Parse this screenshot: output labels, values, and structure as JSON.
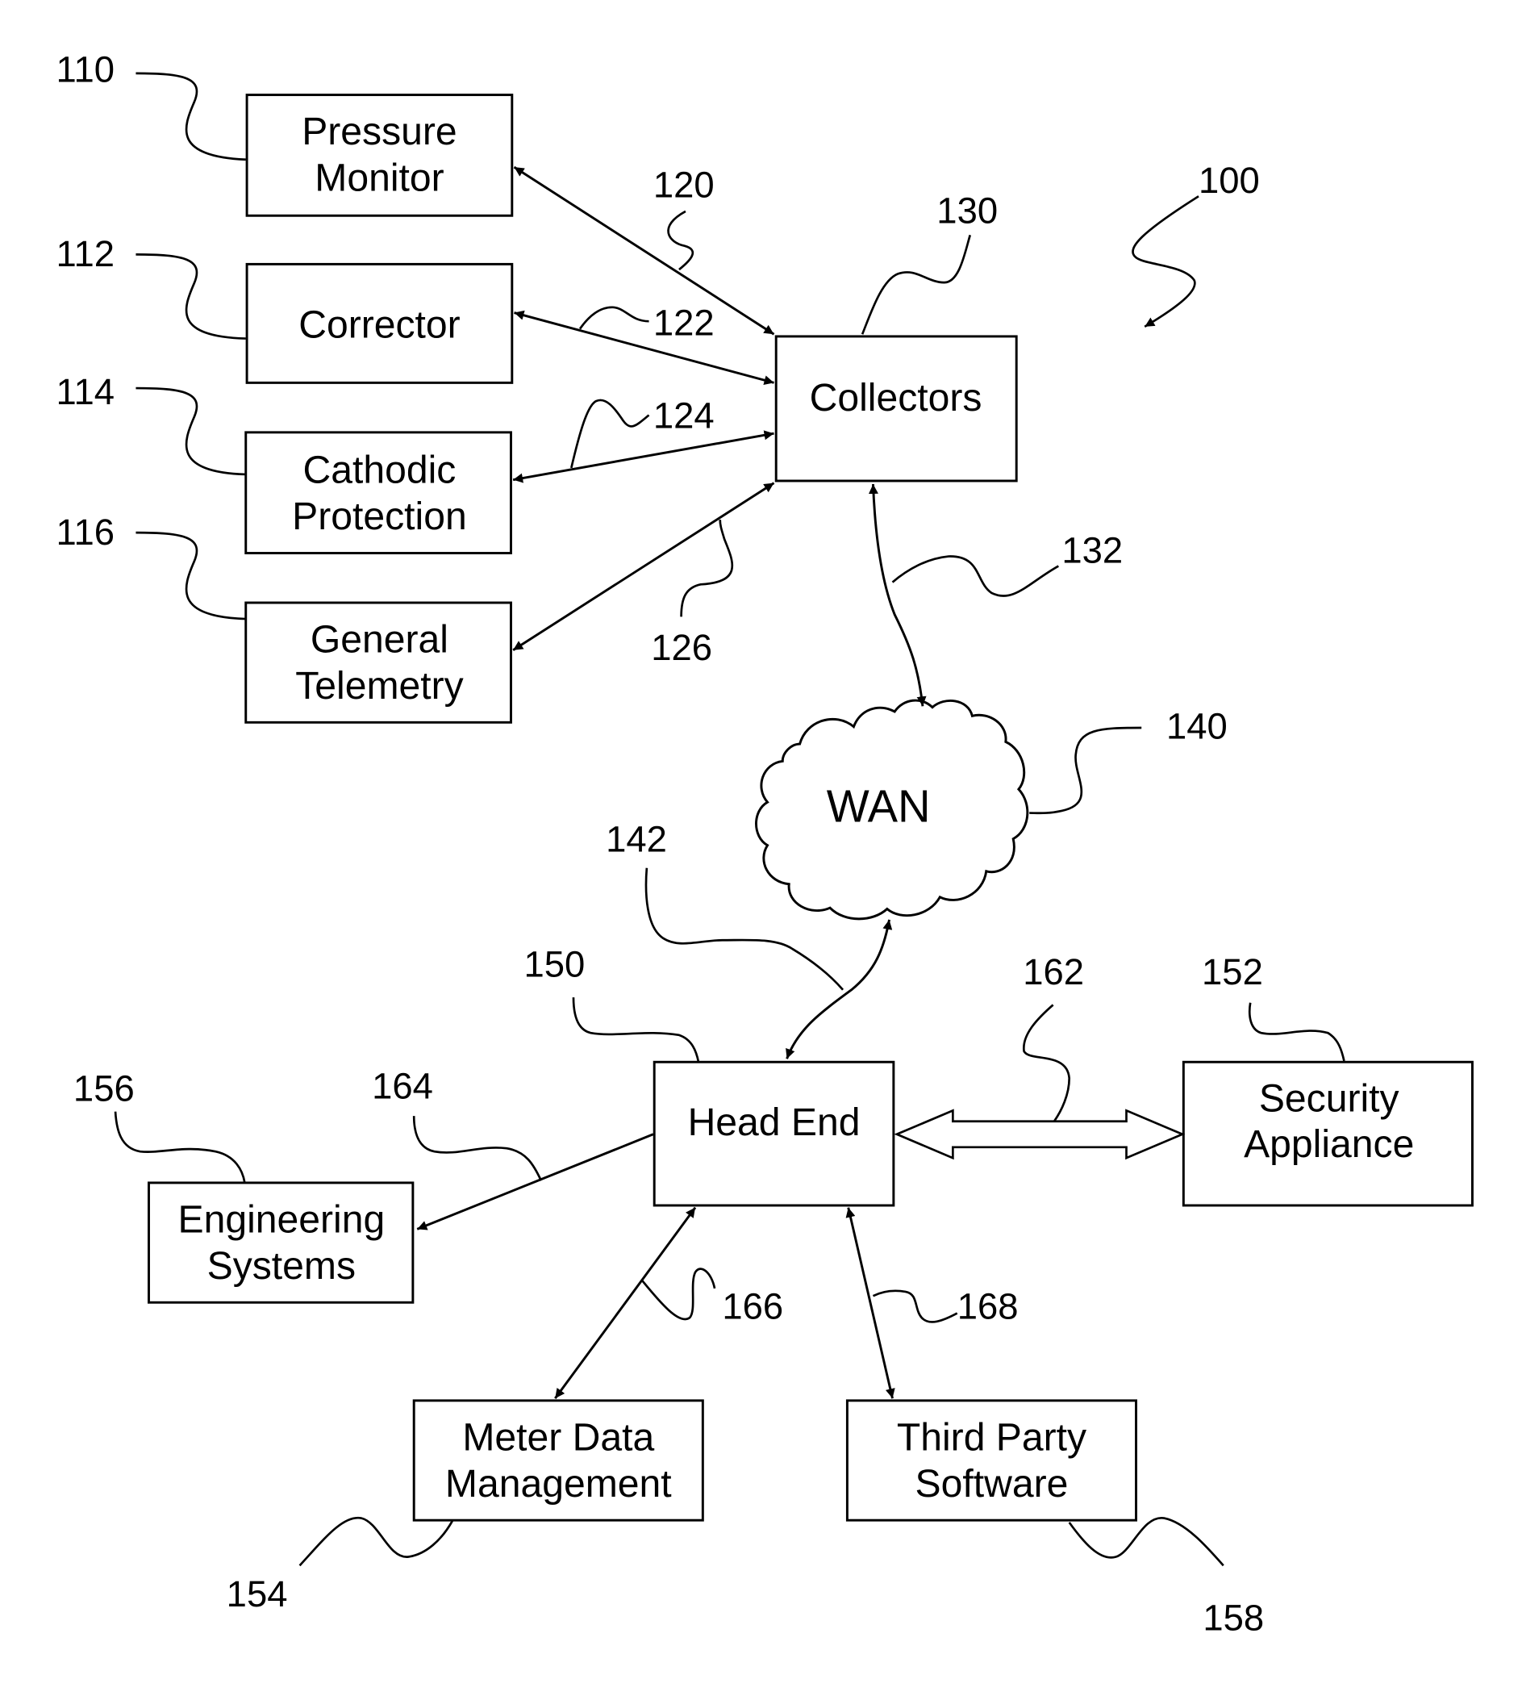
{
  "figure": {
    "system_ref": "100",
    "nodes": {
      "pressure_monitor": {
        "ref": "110",
        "lines": [
          "Pressure",
          "Monitor"
        ]
      },
      "corrector": {
        "ref": "112",
        "lines": [
          "Corrector"
        ]
      },
      "cathodic_protection": {
        "ref": "114",
        "lines": [
          "Cathodic",
          "Protection"
        ]
      },
      "general_telemetry": {
        "ref": "116",
        "lines": [
          "General",
          "Telemetry"
        ]
      },
      "collectors": {
        "ref": "130",
        "lines": [
          "Collectors"
        ]
      },
      "wan": {
        "ref": "140",
        "label": "WAN"
      },
      "head_end": {
        "ref": "150",
        "lines": [
          "Head End"
        ]
      },
      "security_appliance": {
        "ref": "152",
        "lines": [
          "Security",
          "Appliance"
        ]
      },
      "meter_data_management": {
        "ref": "154",
        "lines": [
          "Meter Data",
          "Management"
        ]
      },
      "engineering_systems": {
        "ref": "156",
        "lines": [
          "Engineering",
          "Systems"
        ]
      },
      "third_party_software": {
        "ref": "158",
        "lines": [
          "Third Party",
          "Software"
        ]
      }
    },
    "links": {
      "pm_collectors": {
        "ref": "120",
        "from": "Pressure Monitor",
        "to": "Collectors",
        "direction": "bidirectional"
      },
      "corr_collectors": {
        "ref": "122",
        "from": "Corrector",
        "to": "Collectors",
        "direction": "bidirectional"
      },
      "cp_collectors": {
        "ref": "124",
        "from": "Cathodic Protection",
        "to": "Collectors",
        "direction": "bidirectional"
      },
      "gt_collectors": {
        "ref": "126",
        "from": "General Telemetry",
        "to": "Collectors",
        "direction": "bidirectional"
      },
      "collectors_wan": {
        "ref": "132",
        "from": "Collectors",
        "to": "WAN",
        "direction": "bidirectional"
      },
      "wan_headend": {
        "ref": "142",
        "from": "WAN",
        "to": "Head End",
        "direction": "bidirectional"
      },
      "headend_security": {
        "ref": "162",
        "from": "Head End",
        "to": "Security Appliance",
        "direction": "bidirectional-wide"
      },
      "headend_engineering": {
        "ref": "164",
        "from": "Head End",
        "to": "Engineering Systems",
        "direction": "one-way"
      },
      "headend_mdm": {
        "ref": "166",
        "from": "Head End",
        "to": "Meter Data Management",
        "direction": "bidirectional"
      },
      "headend_thirdparty": {
        "ref": "168",
        "from": "Head End",
        "to": "Third Party Software",
        "direction": "bidirectional"
      }
    }
  }
}
